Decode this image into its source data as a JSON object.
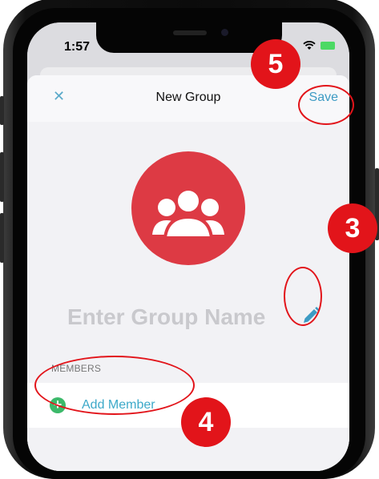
{
  "status_bar": {
    "time": "1:57"
  },
  "nav": {
    "close_icon": "✕",
    "title": "New Group",
    "save_label": "Save"
  },
  "group": {
    "name_placeholder": "Enter Group Name",
    "avatar_icon": "group-icon"
  },
  "members": {
    "section_label": "MEMBERS",
    "add_label": "Add Member"
  },
  "annotations": [
    {
      "number": "5",
      "target": "save-button"
    },
    {
      "number": "3",
      "target": "edit-name-icon"
    },
    {
      "number": "4",
      "target": "add-member-row"
    }
  ],
  "colors": {
    "accent": "#3d9bc4",
    "avatar": "#dd3a44",
    "add_green": "#3cb96a",
    "annotation_red": "#e2141a"
  }
}
